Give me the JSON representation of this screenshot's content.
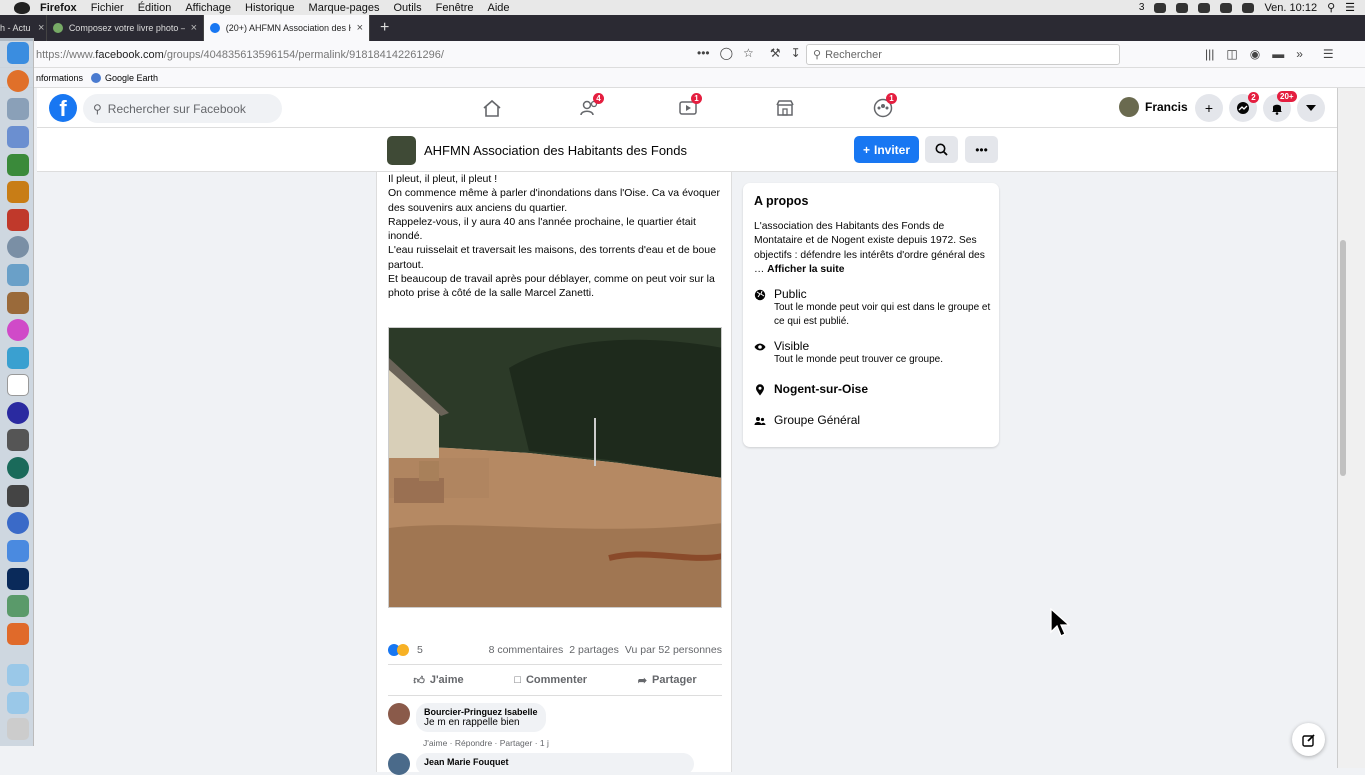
{
  "menubar": {
    "app": "Firefox",
    "items": [
      "Fichier",
      "Édition",
      "Affichage",
      "Historique",
      "Marque-pages",
      "Outils",
      "Fenêtre",
      "Aide"
    ],
    "clock": "Ven. 10:12",
    "status_num": "3"
  },
  "tabs": [
    {
      "label": "h - Actu"
    },
    {
      "label": "Composez votre livre photo – Ph"
    },
    {
      "label": "(20+) AHFMN Association des H"
    }
  ],
  "nav": {
    "url_prefix": "https://www.",
    "url_domain": "facebook.com",
    "url_path": "/groups/404835613596154/permalink/918184142261296/",
    "search_placeholder": "Rechercher"
  },
  "bookmarks": [
    "nformations",
    "Google Earth"
  ],
  "fb": {
    "search_placeholder": "Rechercher sur Facebook",
    "badges": {
      "friends": "4",
      "watch": "1",
      "groups": "1",
      "messenger": "2",
      "notifications": "20+"
    },
    "profile_name": "Francis"
  },
  "group": {
    "name": "AHFMN Association des Habitants des Fonds",
    "invite_label": "Inviter"
  },
  "post": {
    "lines": [
      "Il pleut, il pleut, il pleut !",
      "On commence même à parler d'inondations dans l'Oise. Ca va évoquer des souvenirs aux anciens du quartier.",
      "Rappelez-vous, il y aura 40 ans l'année prochaine, le quartier était inondé.",
      "L'eau ruisselait et traversait les maisons, des torrents d'eau et de boue partout.",
      "Et beaucoup de travail après pour déblayer, comme on peut voir sur la photo prise à côté de la salle Marcel Zanetti."
    ],
    "reaction_count": "5",
    "comments": "8 commentaires",
    "shares": "2 partages",
    "views": "Vu par 52 personnes",
    "like_label": "J'aime",
    "comment_label": "Commenter",
    "share_label": "Partager"
  },
  "comments": [
    {
      "author": "Bourcier-Pringuez Isabelle",
      "text": "Je m en rappelle bien",
      "meta": "J'aime · Répondre · Partager · 1 j"
    },
    {
      "author": "Jean Marie Fouquet",
      "text": ""
    }
  ],
  "about": {
    "title": "A propos",
    "desc": "L'association des Habitants des Fonds de Montataire et de Nogent existe depuis 1972. Ses objectifs : défendre les intérêts d'ordre général des … ",
    "more": "Afficher la suite",
    "public_title": "Public",
    "public_desc": "Tout le monde peut voir qui est dans le groupe et ce qui est publié.",
    "visible_title": "Visible",
    "visible_desc": "Tout le monde peut trouver ce groupe.",
    "location": "Nogent-sur-Oise",
    "category": "Groupe Général"
  }
}
